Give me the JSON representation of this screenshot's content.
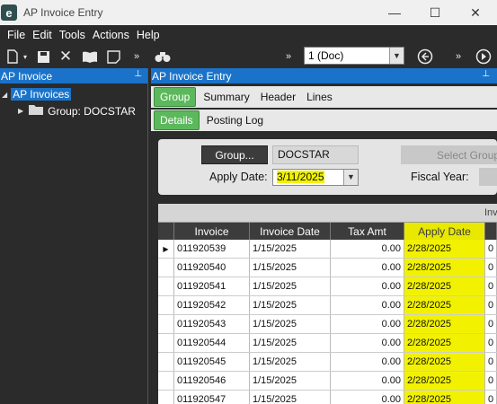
{
  "window": {
    "app_icon_letter": "e",
    "title": "AP Invoice Entry",
    "minimize_glyph": "—",
    "maximize_glyph": "☐",
    "close_glyph": "✕"
  },
  "menu": [
    "File",
    "Edit",
    "Tools",
    "Actions",
    "Help"
  ],
  "toolbar": {
    "doc_select_value": "1 (Doc)",
    "icons": [
      "new-icon",
      "save-icon",
      "delete-icon",
      "open-book-icon",
      "note-icon",
      "binoculars-icon",
      "back-icon",
      "play-icon"
    ]
  },
  "left_panel": {
    "header": "AP Invoice",
    "pin_glyph": "📌",
    "tree": {
      "root": "AP Invoices",
      "child": "Group: DOCSTAR"
    }
  },
  "right_panel": {
    "header": "AP Invoice Entry",
    "pin_glyph": "📌",
    "tabs_row1": [
      "Group",
      "Summary",
      "Header",
      "Lines"
    ],
    "tabs_row2": [
      "Details",
      "Posting Log"
    ],
    "form": {
      "group_button": "Group...",
      "group_value": "DOCSTAR",
      "apply_date_label": "Apply Date:",
      "apply_date_value": "3/11/2025",
      "select_group_button": "Select Group",
      "fiscal_year_label": "Fiscal Year:"
    },
    "grid": {
      "top_label": "Inv",
      "columns": [
        "Invoice",
        "Invoice Date",
        "Tax Amt",
        "Apply Date"
      ],
      "rows": [
        {
          "invoice": "011920539",
          "invoice_date": "1/15/2025",
          "tax_amt": "0.00",
          "apply_date": "2/28/2025",
          "extra": "0"
        },
        {
          "invoice": "011920540",
          "invoice_date": "1/15/2025",
          "tax_amt": "0.00",
          "apply_date": "2/28/2025",
          "extra": "0"
        },
        {
          "invoice": "011920541",
          "invoice_date": "1/15/2025",
          "tax_amt": "0.00",
          "apply_date": "2/28/2025",
          "extra": "0"
        },
        {
          "invoice": "011920542",
          "invoice_date": "1/15/2025",
          "tax_amt": "0.00",
          "apply_date": "2/28/2025",
          "extra": "0"
        },
        {
          "invoice": "011920543",
          "invoice_date": "1/15/2025",
          "tax_amt": "0.00",
          "apply_date": "2/28/2025",
          "extra": "0"
        },
        {
          "invoice": "011920544",
          "invoice_date": "1/15/2025",
          "tax_amt": "0.00",
          "apply_date": "2/28/2025",
          "extra": "0"
        },
        {
          "invoice": "011920545",
          "invoice_date": "1/15/2025",
          "tax_amt": "0.00",
          "apply_date": "2/28/2025",
          "extra": "0"
        },
        {
          "invoice": "011920546",
          "invoice_date": "1/15/2025",
          "tax_amt": "0.00",
          "apply_date": "2/28/2025",
          "extra": "0"
        },
        {
          "invoice": "011920547",
          "invoice_date": "1/15/2025",
          "tax_amt": "0.00",
          "apply_date": "2/28/2025",
          "extra": "0"
        }
      ]
    }
  },
  "colors": {
    "accent_blue": "#1a73c9",
    "tab_green": "#5cb85c",
    "highlight_yellow": "#f2f200",
    "dark_bg": "#2b2b2b"
  }
}
